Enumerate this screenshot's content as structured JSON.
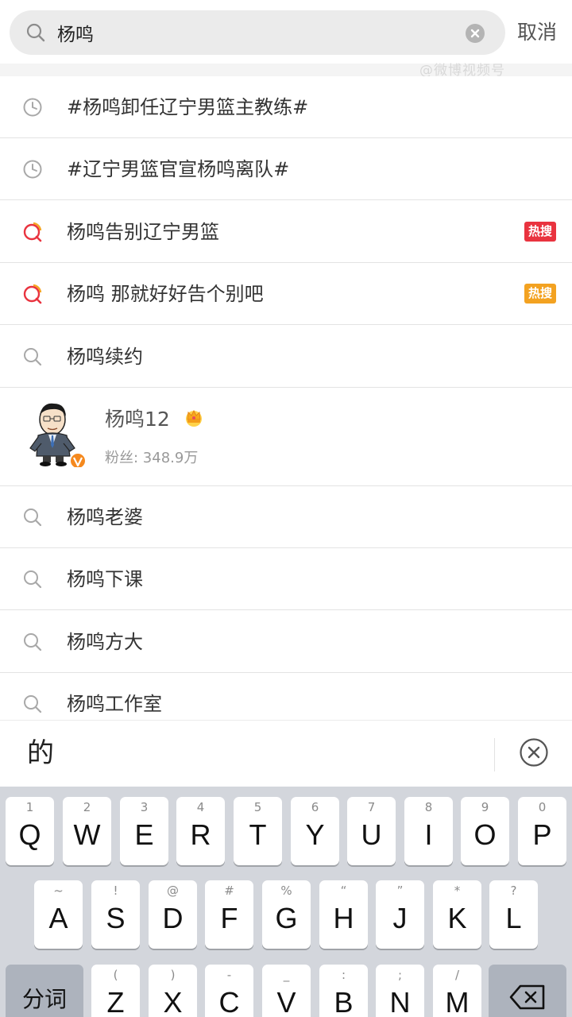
{
  "search": {
    "query": "杨鸣",
    "cancel_label": "取消",
    "watermark": "@微博视频号"
  },
  "suggestions": [
    {
      "text": "#杨鸣卸任辽宁男篮主教练#",
      "icon": "clock-icon"
    },
    {
      "text": "#辽宁男篮官宣杨鸣离队#",
      "icon": "clock-icon"
    },
    {
      "text": "杨鸣告别辽宁男篮",
      "icon": "hot-search-icon",
      "badge": "热搜",
      "badge_color": "#e9333f"
    },
    {
      "text": "杨鸣 那就好好告个别吧",
      "icon": "hot-search-icon",
      "badge": "热搜",
      "badge_color": "#f3a221"
    },
    {
      "text": "杨鸣续约",
      "icon": "search-icon"
    }
  ],
  "user_card": {
    "name": "杨鸣12",
    "fans": "粉丝: 348.9万",
    "verified_color": "#f5891e"
  },
  "suggestions_more": [
    {
      "text": "杨鸣老婆"
    },
    {
      "text": "杨鸣下课"
    },
    {
      "text": "杨鸣方大"
    },
    {
      "text": "杨鸣工作室"
    }
  ],
  "ime": {
    "candidate": "的"
  },
  "keyboard": {
    "row1": [
      {
        "ch": "Q",
        "hint": "1"
      },
      {
        "ch": "W",
        "hint": "2"
      },
      {
        "ch": "E",
        "hint": "3"
      },
      {
        "ch": "R",
        "hint": "4"
      },
      {
        "ch": "T",
        "hint": "5"
      },
      {
        "ch": "Y",
        "hint": "6"
      },
      {
        "ch": "U",
        "hint": "7"
      },
      {
        "ch": "I",
        "hint": "8"
      },
      {
        "ch": "O",
        "hint": "9"
      },
      {
        "ch": "P",
        "hint": "0"
      }
    ],
    "row2": [
      {
        "ch": "A",
        "hint": "~"
      },
      {
        "ch": "S",
        "hint": "!"
      },
      {
        "ch": "D",
        "hint": "@"
      },
      {
        "ch": "F",
        "hint": "#"
      },
      {
        "ch": "G",
        "hint": "%"
      },
      {
        "ch": "H",
        "hint": "“"
      },
      {
        "ch": "J",
        "hint": "”"
      },
      {
        "ch": "K",
        "hint": "*"
      },
      {
        "ch": "L",
        "hint": "?"
      }
    ],
    "row3": [
      {
        "ch": "Z",
        "hint": "("
      },
      {
        "ch": "X",
        "hint": ")"
      },
      {
        "ch": "C",
        "hint": "-"
      },
      {
        "ch": "V",
        "hint": "_"
      },
      {
        "ch": "B",
        "hint": ":"
      },
      {
        "ch": "N",
        "hint": ";"
      },
      {
        "ch": "M",
        "hint": "/"
      }
    ],
    "segment_label": "分词"
  },
  "colors": {
    "hot_red": "#e9333f",
    "hot_orange": "#f3a221",
    "keyboard_bg": "#d3d6dc"
  }
}
